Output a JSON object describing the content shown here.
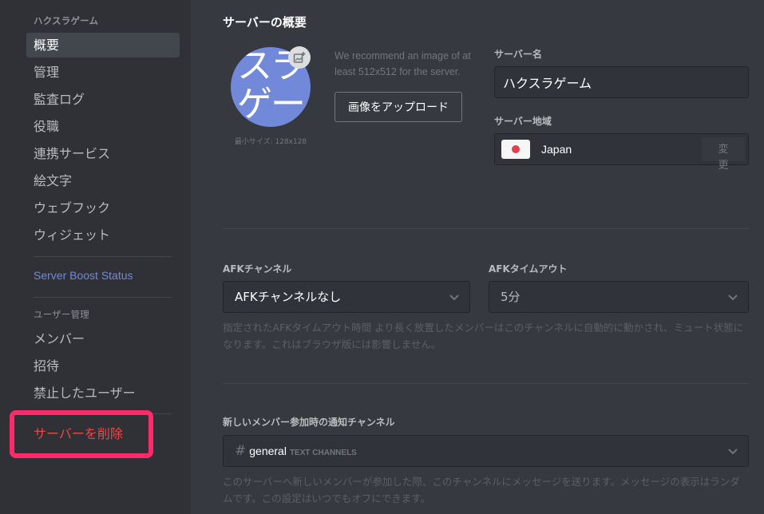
{
  "sidebar": {
    "server_header": "ハクスラゲーム",
    "items": [
      {
        "label": "概要",
        "active": true
      },
      {
        "label": "管理"
      },
      {
        "label": "監査ログ"
      },
      {
        "label": "役職"
      },
      {
        "label": "連携サービス"
      },
      {
        "label": "絵文字"
      },
      {
        "label": "ウェブフック"
      },
      {
        "label": "ウィジェット"
      }
    ],
    "boost_label": "Server Boost Status",
    "user_mgmt_header": "ユーザー管理",
    "user_items": [
      {
        "label": "メンバー"
      },
      {
        "label": "招待"
      },
      {
        "label": "禁止したユーザー"
      }
    ],
    "delete_label": "サーバーを削除"
  },
  "overview": {
    "title": "サーバーの概要",
    "icon_text": "スラゲー",
    "min_size": "最小サイズ: 128x128",
    "recommend": "We recommend an image of at least 512x512 for the server.",
    "upload_label": "画像をアップロード",
    "server_name_label": "サーバー名",
    "server_name_value": "ハクスラゲーム",
    "region_label": "サーバー地域",
    "region_value": "Japan",
    "change_label": "変更"
  },
  "afk": {
    "channel_label": "AFKチャンネル",
    "channel_value": "AFKチャンネルなし",
    "timeout_label": "AFKタイムアウト",
    "timeout_value": "5分",
    "help": "指定されたAFKタイムアウト時間 より長く放置したメンバーはこのチャンネルに自動的に動かされ、ミュート状態になります。これはブラウザ版には影響しません。"
  },
  "welcome": {
    "label": "新しいメンバー参加時の通知チャンネル",
    "hash": "#",
    "channel": "general",
    "category": "TEXT CHANNELS",
    "help": "このサーバーへ新しいメンバーが参加した際、このチャンネルにメッセージを送ります。メッセージの表示はランダムです。この設定はいつでもオフにできます。"
  },
  "colors": {
    "accent": "#7289da",
    "danger": "#f04747",
    "highlight": "#ff2a6a"
  }
}
